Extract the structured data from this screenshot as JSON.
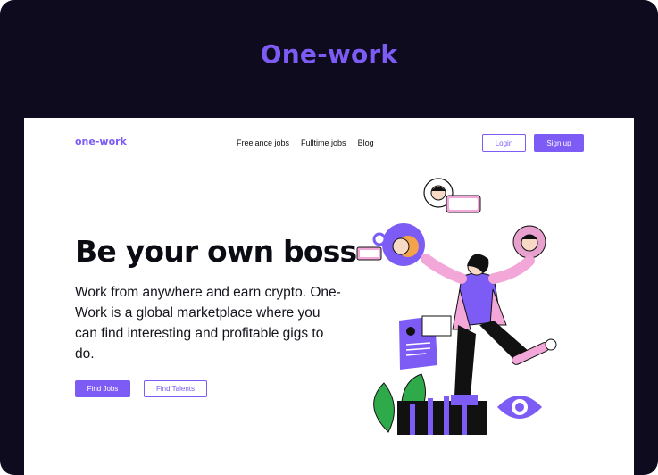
{
  "frame": {
    "title": "One-work"
  },
  "header": {
    "logo": "one-work",
    "nav": [
      "Freelance jobs",
      "Fulltime jobs",
      "Blog"
    ],
    "login_label": "Login",
    "signup_label": "Sign up"
  },
  "hero": {
    "title": "Be your own boss",
    "subtitle": "Work from anywhere and earn crypto. One-Work is a global marketplace where you can find interesting and profitable gigs to do.",
    "find_jobs_label": "Find Jobs",
    "find_talents_label": "Find Talents"
  },
  "colors": {
    "accent": "#7c5cf5",
    "frame_bg": "#0f0b1f",
    "pink": "#f2a7d8",
    "orange": "#f5a34a",
    "green": "#2faa4a"
  }
}
